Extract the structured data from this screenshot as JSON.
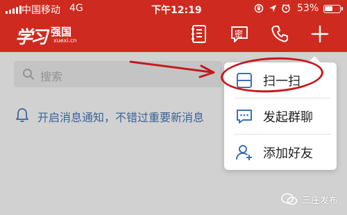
{
  "status_bar": {
    "carrier": "中国移动",
    "network": "4G",
    "time": "下午12:19",
    "battery_percent_label": "53%",
    "battery_level": 0.53
  },
  "header": {
    "logo": {
      "script": "学习",
      "text": "强国",
      "sub": "xuexi.cn"
    },
    "icons": [
      "notebook-icon",
      "secret-chat-icon",
      "phone-icon",
      "plus-icon"
    ],
    "secret_label": "密"
  },
  "search": {
    "placeholder": "搜索"
  },
  "notification": {
    "text": "开启消息通知，不错过重要新消息"
  },
  "menu": {
    "items": [
      {
        "label": "扫一扫",
        "icon": "scan-icon"
      },
      {
        "label": "发起群聊",
        "icon": "group-chat-icon"
      },
      {
        "label": "添加好友",
        "icon": "add-friend-icon"
      }
    ]
  },
  "watermark": {
    "text": "三庄发布"
  },
  "colors": {
    "header_red": "#cf2a1f",
    "link_blue": "#4a79b9",
    "icon_blue": "#3c6fb4",
    "annotation_red": "#c4191c"
  }
}
